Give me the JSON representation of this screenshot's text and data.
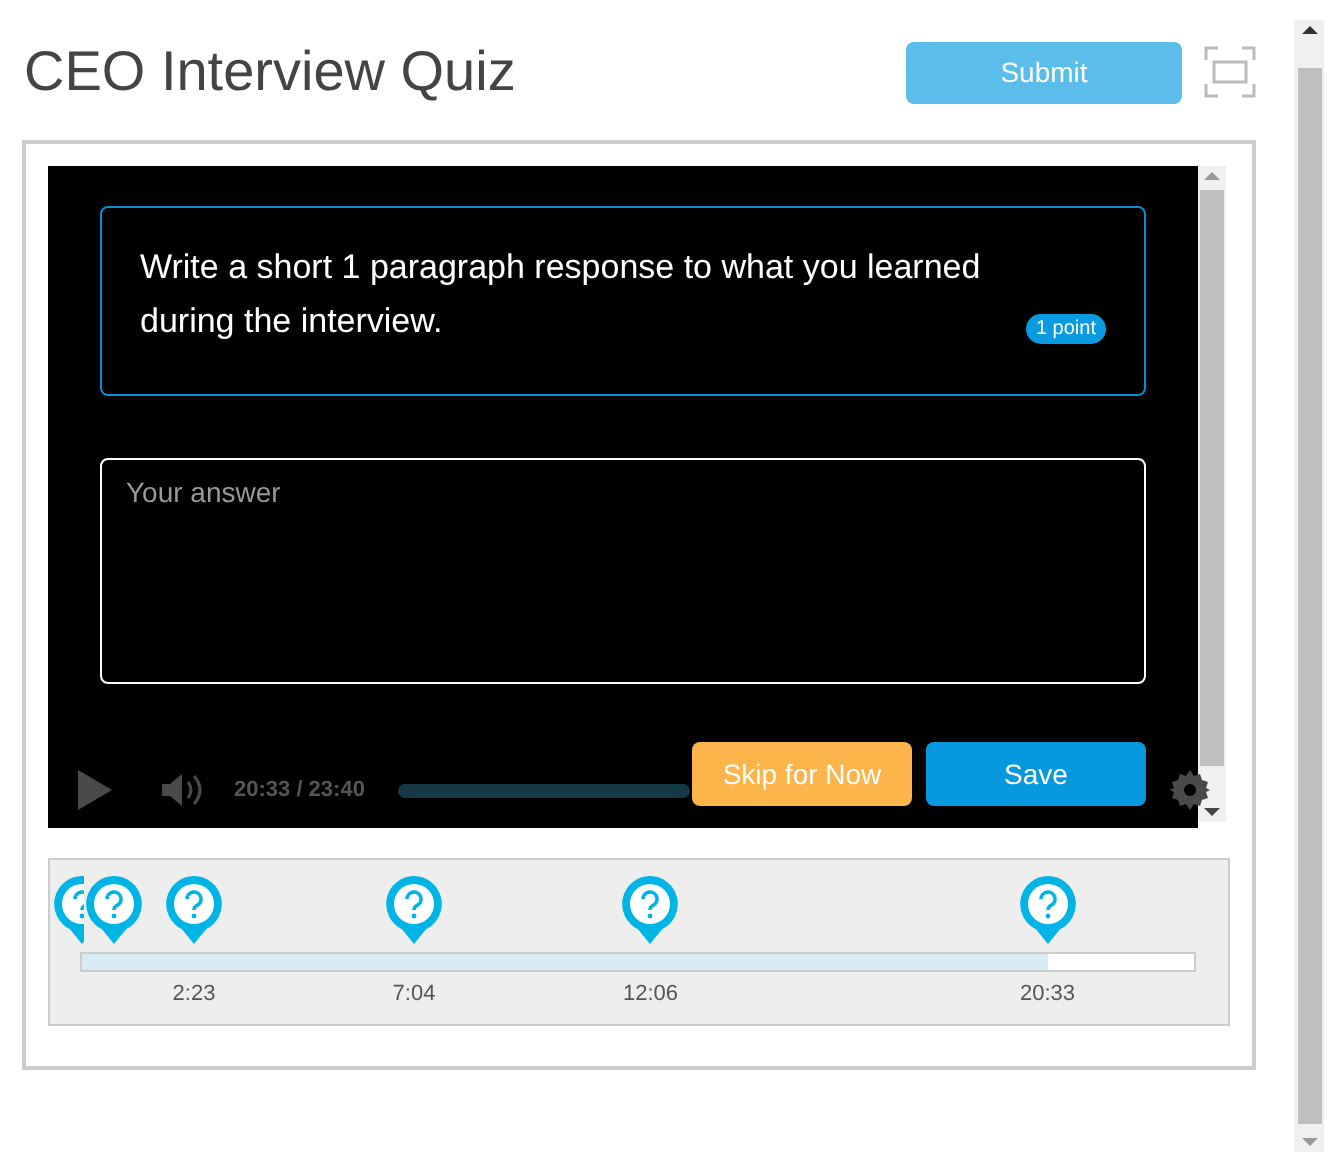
{
  "title": "CEO Interview Quiz",
  "submit_button": "Submit",
  "question": {
    "text": "Write a short 1 paragraph response to what you learned during the interview.",
    "points": "1 point"
  },
  "answer": {
    "placeholder": "Your answer"
  },
  "player": {
    "time": "20:33 / 23:40"
  },
  "buttons": [
    {
      "label": "Skip for Now",
      "kind": "secondary"
    },
    {
      "label": "Save",
      "kind": "primary"
    }
  ],
  "timeline": {
    "level": 0.869,
    "markers": [
      {
        "kind": "question"
      },
      {
        "kind": "question"
      },
      {
        "kind": "question",
        "label": "2:23"
      },
      {
        "kind": "question",
        "label": "7:04"
      },
      {
        "kind": "question",
        "label": "12:06"
      },
      {
        "kind": "question",
        "label": "20:33"
      }
    ]
  }
}
